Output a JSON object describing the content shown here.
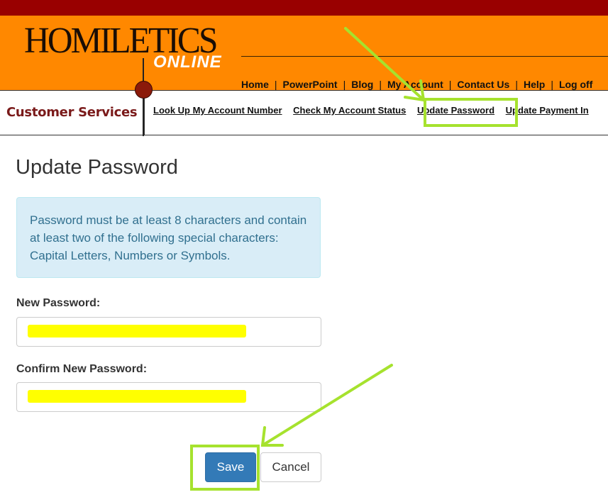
{
  "header": {
    "logo_main": "HOMILETICS",
    "logo_sub": "ONLINE",
    "top_nav": [
      "Home",
      "PowerPoint",
      "Blog",
      "My Account",
      "Contact Us",
      "Help",
      "Log off"
    ]
  },
  "subnav": {
    "section_title": "Customer Services",
    "links": [
      "Look Up My Account Number",
      "Check My Account Status",
      "Update Password",
      "Update Payment In"
    ]
  },
  "main": {
    "title": "Update Password",
    "info": "Password must be at least 8 characters and contain at least two of the following special characters: Capital Letters, Numbers or Symbols.",
    "new_password_label": "New Password:",
    "confirm_password_label": "Confirm New Password:",
    "save_label": "Save",
    "cancel_label": "Cancel"
  },
  "colors": {
    "topbar": "#990000",
    "banner": "#ff8800",
    "brand_red": "#7a1a1a",
    "primary_button": "#337ab7",
    "annotation": "#a6e22e",
    "redaction": "#ffff00"
  }
}
